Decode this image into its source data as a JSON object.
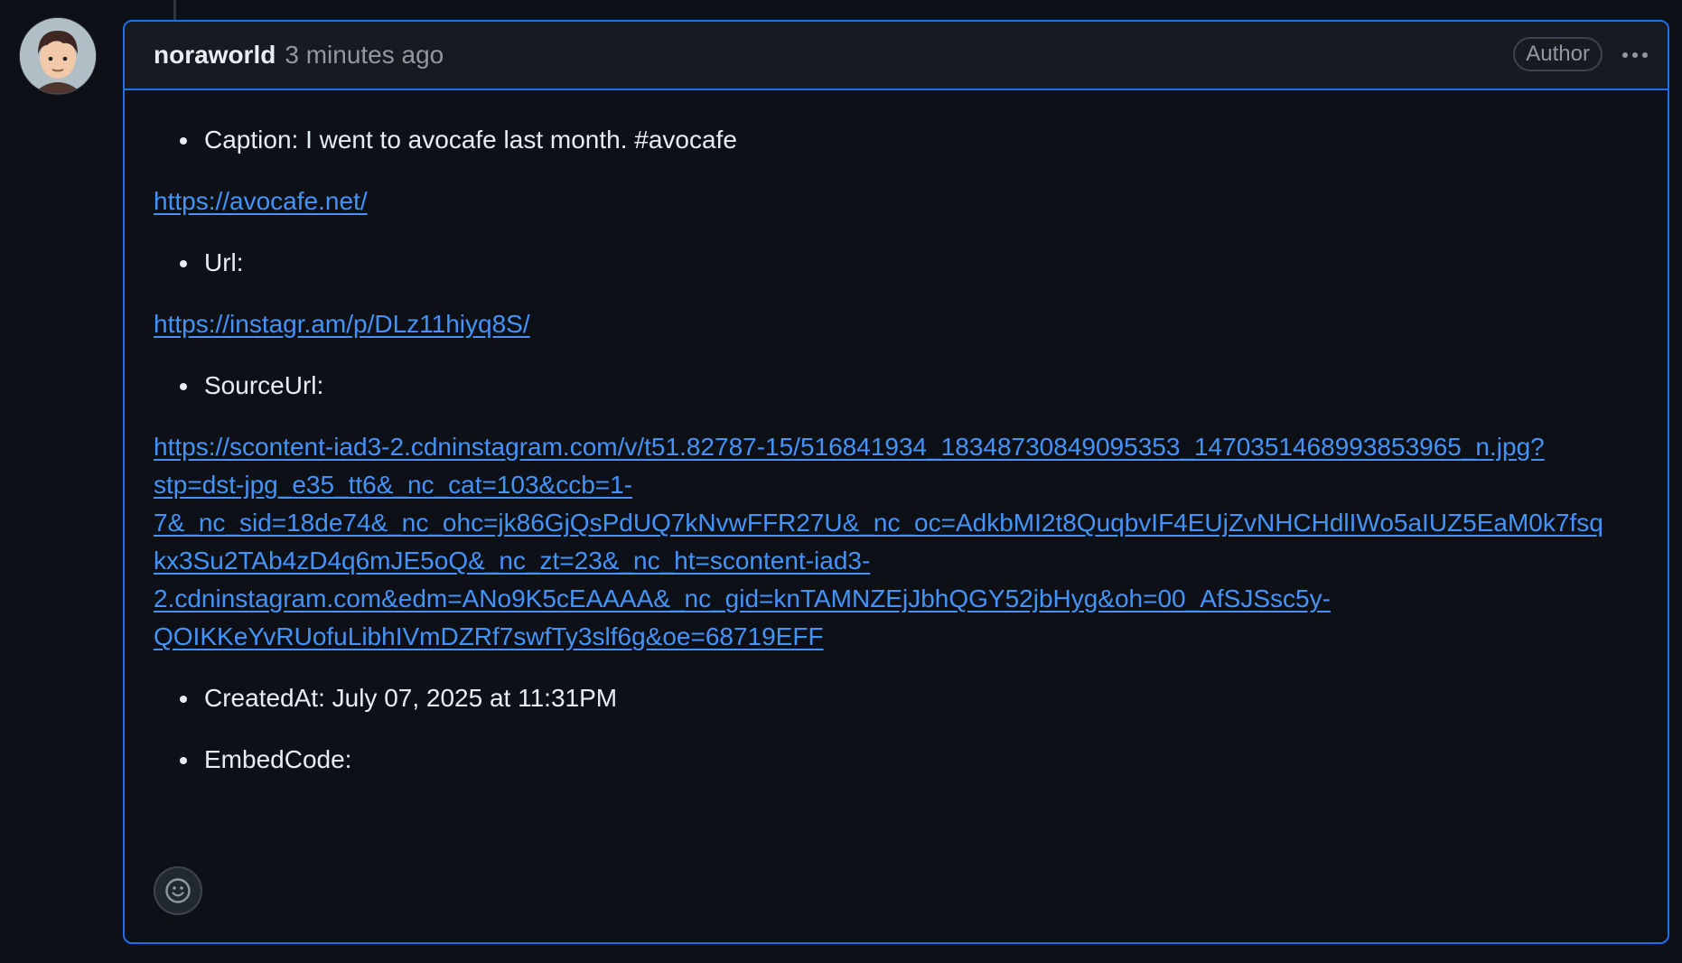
{
  "comment": {
    "author": "noraworld",
    "timestamp": "3 minutes ago",
    "badge": "Author",
    "fields": [
      {
        "label": "Caption: I went to avocafe last month. #avocafe",
        "link": "https://avocafe.net/"
      },
      {
        "label": "Url:",
        "link": "https://instagr.am/p/DLz11hiyq8S/"
      },
      {
        "label": "SourceUrl:",
        "link_lines": [
          "https://scontent-iad3-2.cdninstagram.com/v/t51.82787-15/516841934_18348730849095353_1470351468993853965_n.jpg?",
          "stp=dst-jpg_e35_tt6&_nc_cat=103&ccb=1-",
          "7&_nc_sid=18de74&_nc_ohc=jk86GjQsPdUQ7kNvwFFR27U&_nc_oc=AdkbMI2t8QuqbvIF4EUjZvNHCHdlIWo5aIUZ5EaM0k7fsq",
          "kx3Su2TAb4zD4q6mJE5oQ&_nc_zt=23&_nc_ht=scontent-iad3-",
          "2.cdninstagram.com&edm=ANo9K5cEAAAA&_nc_gid=knTAMNZEjJbhQGY52jbHyg&oh=00_AfSJSsc5y-",
          "QOIKKeYvRUofuLibhIVmDZRf7swfTy3slf6g&oe=68719EFF"
        ]
      },
      {
        "label": "CreatedAt: July 07, 2025 at 11:31PM"
      },
      {
        "label": "EmbedCode:"
      }
    ]
  },
  "icons": {
    "more": "kebab-horizontal-icon",
    "reaction": "smiley-icon"
  },
  "colors": {
    "background": "#0d1117",
    "header": "#161b22",
    "border_active": "#1f6feb",
    "link": "#4493f8",
    "muted": "#9198a1"
  }
}
